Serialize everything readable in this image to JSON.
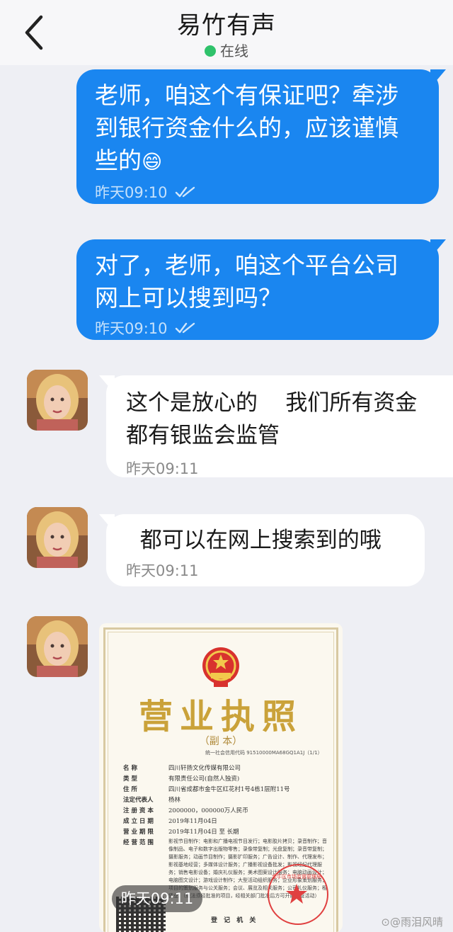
{
  "header": {
    "title": "易竹有声",
    "status": "在线",
    "status_color": "#2fc26b",
    "back_icon": "chevron-left-icon"
  },
  "messages": [
    {
      "direction": "outgoing",
      "lines": [
        "老师，咱这个有保证吧？牵涉",
        "到银行资金什么的，应该谨慎",
        "些的"
      ],
      "emoji": "😄",
      "time": "昨天09:10",
      "read_icon": "double-check-icon"
    },
    {
      "direction": "outgoing",
      "lines": [
        "对了，老师，咱这个平台公司",
        "网上可以搜到吗？"
      ],
      "time": "昨天09:10",
      "read_icon": "double-check-icon"
    },
    {
      "direction": "incoming",
      "lines": [
        "这个是放心的    我们所有资金",
        "都有银监会监管"
      ],
      "time": "昨天09:11"
    },
    {
      "direction": "incoming",
      "lines": [
        "  都可以在网上搜索到的哦"
      ],
      "time": "昨天09:11"
    },
    {
      "direction": "incoming",
      "type": "image",
      "time": "昨天09:11"
    }
  ],
  "license": {
    "title": "营业执照",
    "subtitle": "（副 本）",
    "credit_code": "统一社会信用代码 91510000MA68GQ1A1J（1/1）",
    "rows": [
      {
        "k": "名        称",
        "v": "四川轩扬文化传媒有限公司"
      },
      {
        "k": "类        型",
        "v": "有限责任公司(自然人独资)"
      },
      {
        "k": "住        所",
        "v": "四川省成都市金牛区红花村1号4栋1层附11号"
      },
      {
        "k": "法定代表人",
        "v": "杨林"
      },
      {
        "k": "注 册 资 本",
        "v": "2000000，000000万人民币"
      },
      {
        "k": "成 立 日 期",
        "v": "2019年11月04日"
      },
      {
        "k": "营 业 期 限",
        "v": "2019年11月04日  至  长期"
      },
      {
        "k": "经 营 范 围",
        "v": ""
      }
    ],
    "scope": "影视节目制作：电影和广播电视节目发行；电影胶片拷贝；录音制作；音像制品、电子和数字出版物零售；录像带复制；光盘复制；录音带复制；摄影服务；动画节目制作；摄影扩印服务；广告设计、制作、代理发布；影视基地经营；多媒体设计服务；广播影视设备批发；影视经纪代理服务；销售电影设备；婚庆礼仪服务；美术图案设计服务；电脑动画设计；电脑图文设计；游戏设计制作；大型活动组织服务；企业形象策划服务；项目的策划服务与公关服务；会议、展览及相关服务；公司礼仪服务；租赁业。（依法须经批准的项目，经相关部门批准后方可开展经营活动）",
    "registration": "登 记 机 关",
    "seal_text": "金牛区市场监督管理局"
  },
  "watermark": "⊙@雨泪风晴"
}
